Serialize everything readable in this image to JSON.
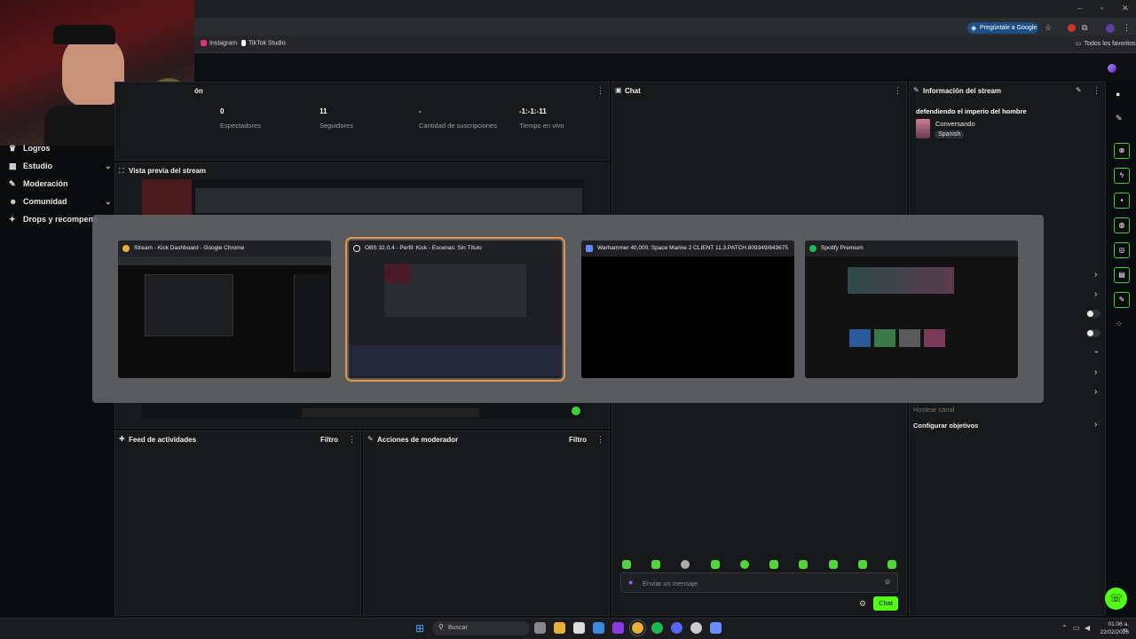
{
  "browser": {
    "ask_google": "Pregúntale a Google",
    "bookmarks": [
      {
        "label": "Instagram",
        "color": "#e1306c"
      },
      {
        "label": "TikTok Studio",
        "color": "#ffffff"
      }
    ],
    "all_favorites": "Todos los favoritos"
  },
  "sidebar": {
    "items": [
      {
        "label": "Logros",
        "icon": "trophy-icon",
        "glyph": "♛"
      },
      {
        "label": "Estudio",
        "icon": "studio-icon",
        "glyph": "▦"
      },
      {
        "label": "Moderación",
        "icon": "wrench-icon",
        "glyph": "✎"
      },
      {
        "label": "Comunidad",
        "icon": "people-icon",
        "glyph": "☻"
      },
      {
        "label": "Drops y recompensas",
        "icon": "gift-icon",
        "glyph": "✦"
      }
    ]
  },
  "stats_panel": {
    "title_suffix": "ón",
    "stats": [
      {
        "value": "0",
        "label": "Espectadores"
      },
      {
        "value": "11",
        "label": "Seguidores"
      },
      {
        "value": "-",
        "label": "Cantidad de suscripciones"
      },
      {
        "value": "-1:-1:-11",
        "label": "Tiempo en vivo"
      }
    ]
  },
  "preview_panel": {
    "title": "Vista previa del stream"
  },
  "chat_panel": {
    "title": "Chat",
    "input_placeholder": "Enviar un mensaje",
    "send_label": "Chat"
  },
  "stream_info": {
    "title": "Información del stream",
    "stream_title": "defendiendo el imperio del hombre",
    "category": "Conversando",
    "language": "Spanish",
    "host_channel": "Hostear canal",
    "configure_goals": "Configurar objetivos"
  },
  "activity_feed": {
    "title": "Feed de actividades",
    "filter": "Filtro"
  },
  "mod_actions": {
    "title": "Acciones de moderador",
    "filter": "Filtro"
  },
  "task_switcher": {
    "windows": [
      {
        "title": "Stream - Kick Dashboard - Google Chrome",
        "icon": "chrome-icon",
        "color": "#e8b03a"
      },
      {
        "title": "OBS 32.0.4 - Perfil: Kick - Escenas: Sin Título",
        "icon": "obs-icon",
        "color": "#dddddd"
      },
      {
        "title": "Warhammer 40,000: Space Marine 2 CLIENT 11.3.PATCH.809349/843675",
        "icon": "warhammer-icon",
        "color": "#6a8cff"
      },
      {
        "title": "Spotify Premium",
        "icon": "spotify-icon",
        "color": "#1db954"
      }
    ],
    "selected_index": 1
  },
  "taskbar": {
    "search_placeholder": "Buscar",
    "time": "01:06 a. m.",
    "date": "22/02/2026"
  },
  "colors": {
    "kick_green": "#53fc18",
    "accent_select": "#e8924a"
  }
}
